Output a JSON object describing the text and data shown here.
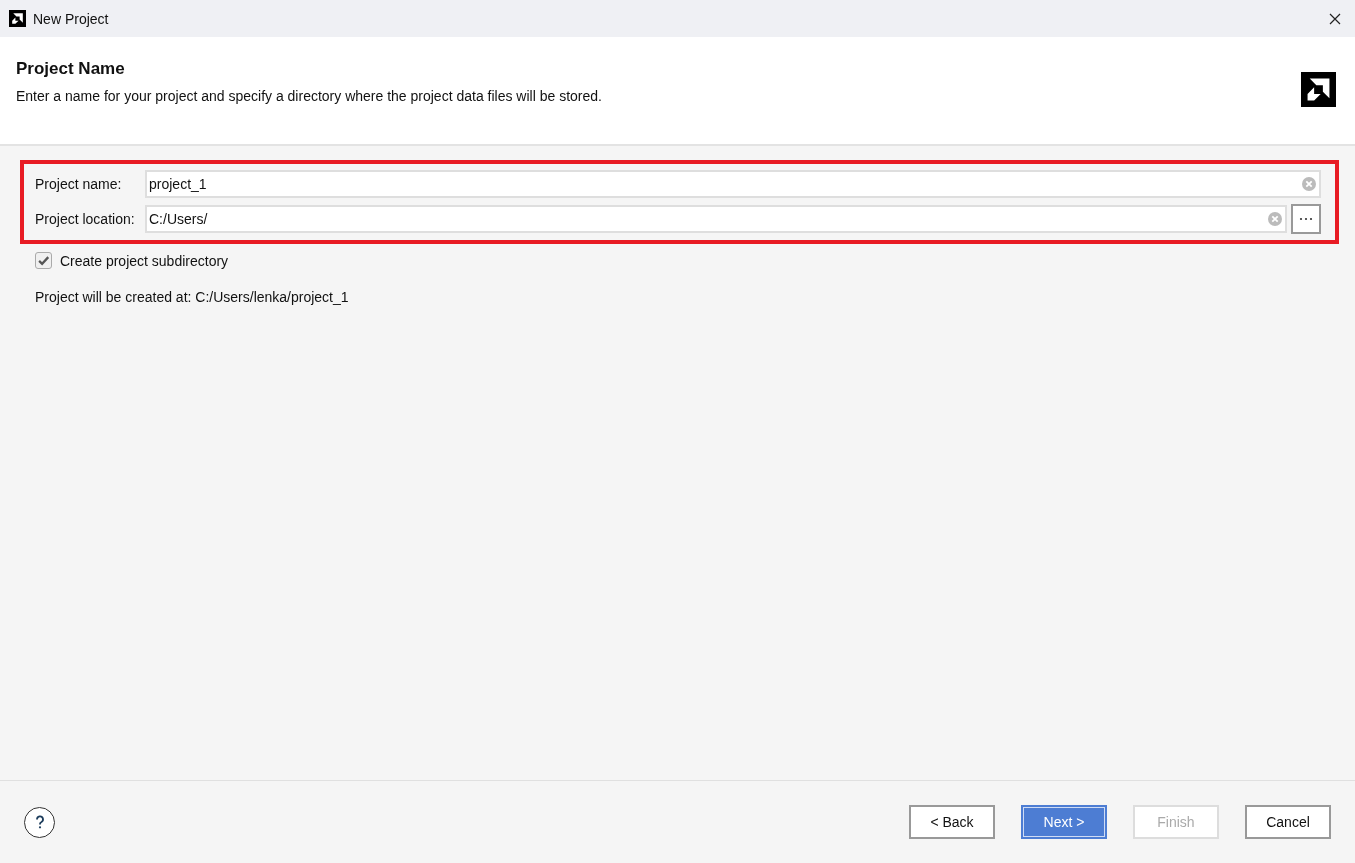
{
  "window": {
    "title": "New Project"
  },
  "header": {
    "title": "Project Name",
    "description": "Enter a name for your project and specify a directory where the project data files will be stored."
  },
  "form": {
    "highlighted": true,
    "fields": [
      {
        "label": "Project name:",
        "value": "project_1",
        "browse": false
      },
      {
        "label": "Project location:",
        "value": "C:/Users/",
        "browse": true
      }
    ]
  },
  "subdirectory": {
    "label": "Create project subdirectory",
    "checked": true
  },
  "summary": "Project will be created at: C:/Users/lenka/project_1",
  "buttons": [
    {
      "label": "< Back",
      "disabled": false,
      "default": false
    },
    {
      "label": "Next >",
      "disabled": false,
      "default": true
    },
    {
      "label": "Finish",
      "disabled": true,
      "default": false
    },
    {
      "label": "Cancel",
      "disabled": false,
      "default": false
    }
  ]
}
